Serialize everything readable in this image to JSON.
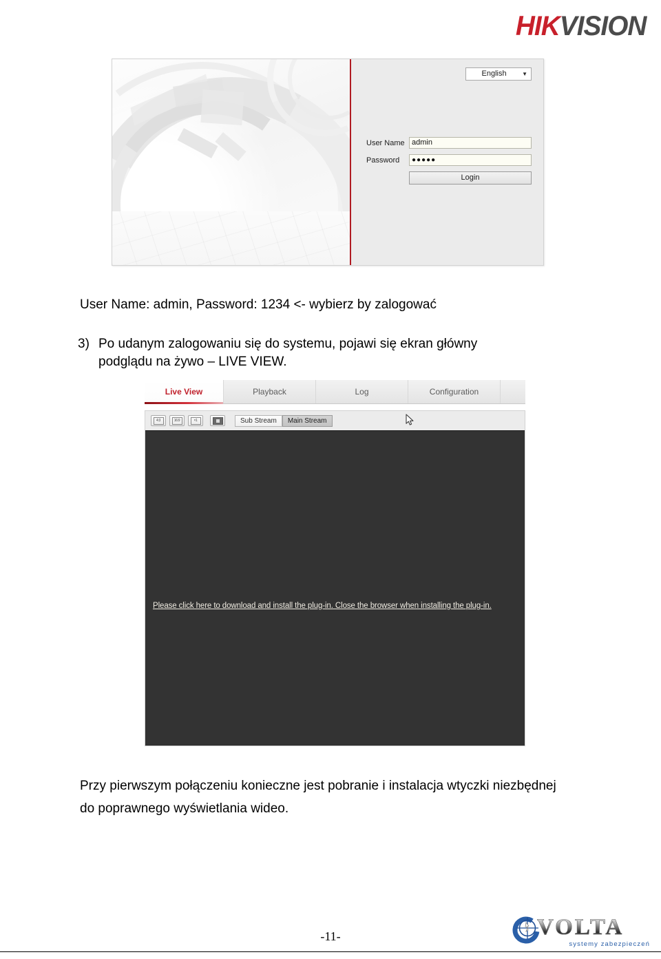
{
  "header": {
    "brand_hik": "HIK",
    "brand_vision": "VISION",
    "brand_full": "HIKVISION",
    "brand_red": "#c8202b",
    "brand_gray": "#4b4b4b"
  },
  "login_screenshot": {
    "language_select": {
      "value": "English",
      "caret": "chevron-down-icon"
    },
    "fields": [
      {
        "label": "User Name",
        "value": "admin"
      },
      {
        "label": "Password",
        "value": "●●●●●"
      }
    ],
    "login_button": "Login",
    "accent_line_color": "#b01b22"
  },
  "body": {
    "caption": "User Name: admin, Password: 1234 <- wybierz by zalogować",
    "step_number": "3)",
    "step_text": "Po udanym zalogowaniu się do systemu, pojawi się ekran główny podglądu na żywo – LIVE VIEW.",
    "closing_paragraph": "Przy pierwszym połączeniu konieczne jest pobranie i instalacja wtyczki niezbędnej do poprawnego wyświetlania wideo."
  },
  "live_view_screenshot": {
    "tabs": [
      {
        "label": "Live View",
        "active": true
      },
      {
        "label": "Playback",
        "active": false
      },
      {
        "label": "Log",
        "active": false
      },
      {
        "label": "Configuration",
        "active": false
      }
    ],
    "active_tab_color": "#c0212c",
    "toolbar": {
      "aspect_4_3": "4:3",
      "aspect_16_9": "16:9",
      "original_size": "×1",
      "full_window_icon": "full-window-icon",
      "sub_stream": "Sub Stream",
      "main_stream": "Main Stream",
      "selected_stream": "Main Stream"
    },
    "video_area": {
      "background": "#333333",
      "plugin_message": "Please click here to download and install the plug-in. Close the browser when installing the plug-in."
    },
    "cursor": "arrow-cursor"
  },
  "footer": {
    "page_number": "-11-",
    "volta_word": "VOLTA",
    "volta_tagline": "systemy zabezpieczeń",
    "volta_mark": "crosshair-target-icon",
    "tagline_color": "#2a5fa8"
  }
}
